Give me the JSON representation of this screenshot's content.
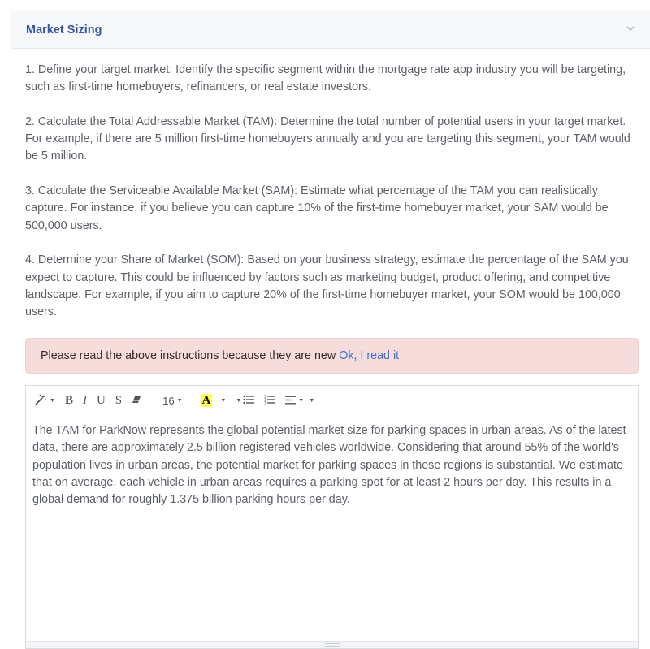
{
  "panel": {
    "title": "Market Sizing"
  },
  "instructions": [
    "1. Define your target market: Identify the specific segment within the mortgage rate app industry you will be targeting, such as first-time homebuyers, refinancers, or real estate investors.",
    "2. Calculate the Total Addressable Market (TAM): Determine the total number of potential users in your target market. For example, if there are 5 million first-time homebuyers annually and you are targeting this segment, your TAM would be 5 million.",
    "3. Calculate the Serviceable Available Market (SAM): Estimate what percentage of the TAM you can realistically capture. For instance, if you believe you can capture 10% of the first-time homebuyer market, your SAM would be 500,000 users.",
    "4. Determine your Share of Market (SOM): Based on your business strategy, estimate the percentage of the SAM you expect to capture. This could be influenced by factors such as marketing budget, product offering, and competitive landscape. For example, if you aim to capture 20% of the first-time homebuyer market, your SOM would be 100,000 users."
  ],
  "alert": {
    "message": "Please read the above instructions because they are new",
    "link": "Ok, I read it"
  },
  "toolbar": {
    "bold": "B",
    "italic": "I",
    "underline": "U",
    "strike": "S",
    "font_size": "16",
    "color": "A"
  },
  "editor": {
    "content": "The TAM for ParkNow represents the global potential market size for parking spaces in urban areas. As of the latest data, there are approximately 2.5 billion registered vehicles worldwide. Considering that around 55% of the world's population lives in urban areas, the potential market for parking spaces in these regions is substantial. We estimate that on average, each vehicle in urban areas requires a parking spot for at least 2 hours per day. This results in a global demand for roughly 1.375 billion parking hours per day."
  },
  "icons": {
    "header": "chevron-down-icon",
    "style": "magic-wand-icon",
    "eraser": "eraser-icon",
    "unordered_list": "unordered-list-icon",
    "ordered_list": "ordered-list-icon",
    "align": "align-left-icon"
  },
  "colors": {
    "title": "#3653a8",
    "alert_bg": "#f6dcdb",
    "link": "#3d6fd1",
    "highlight": "#ffff5a"
  }
}
